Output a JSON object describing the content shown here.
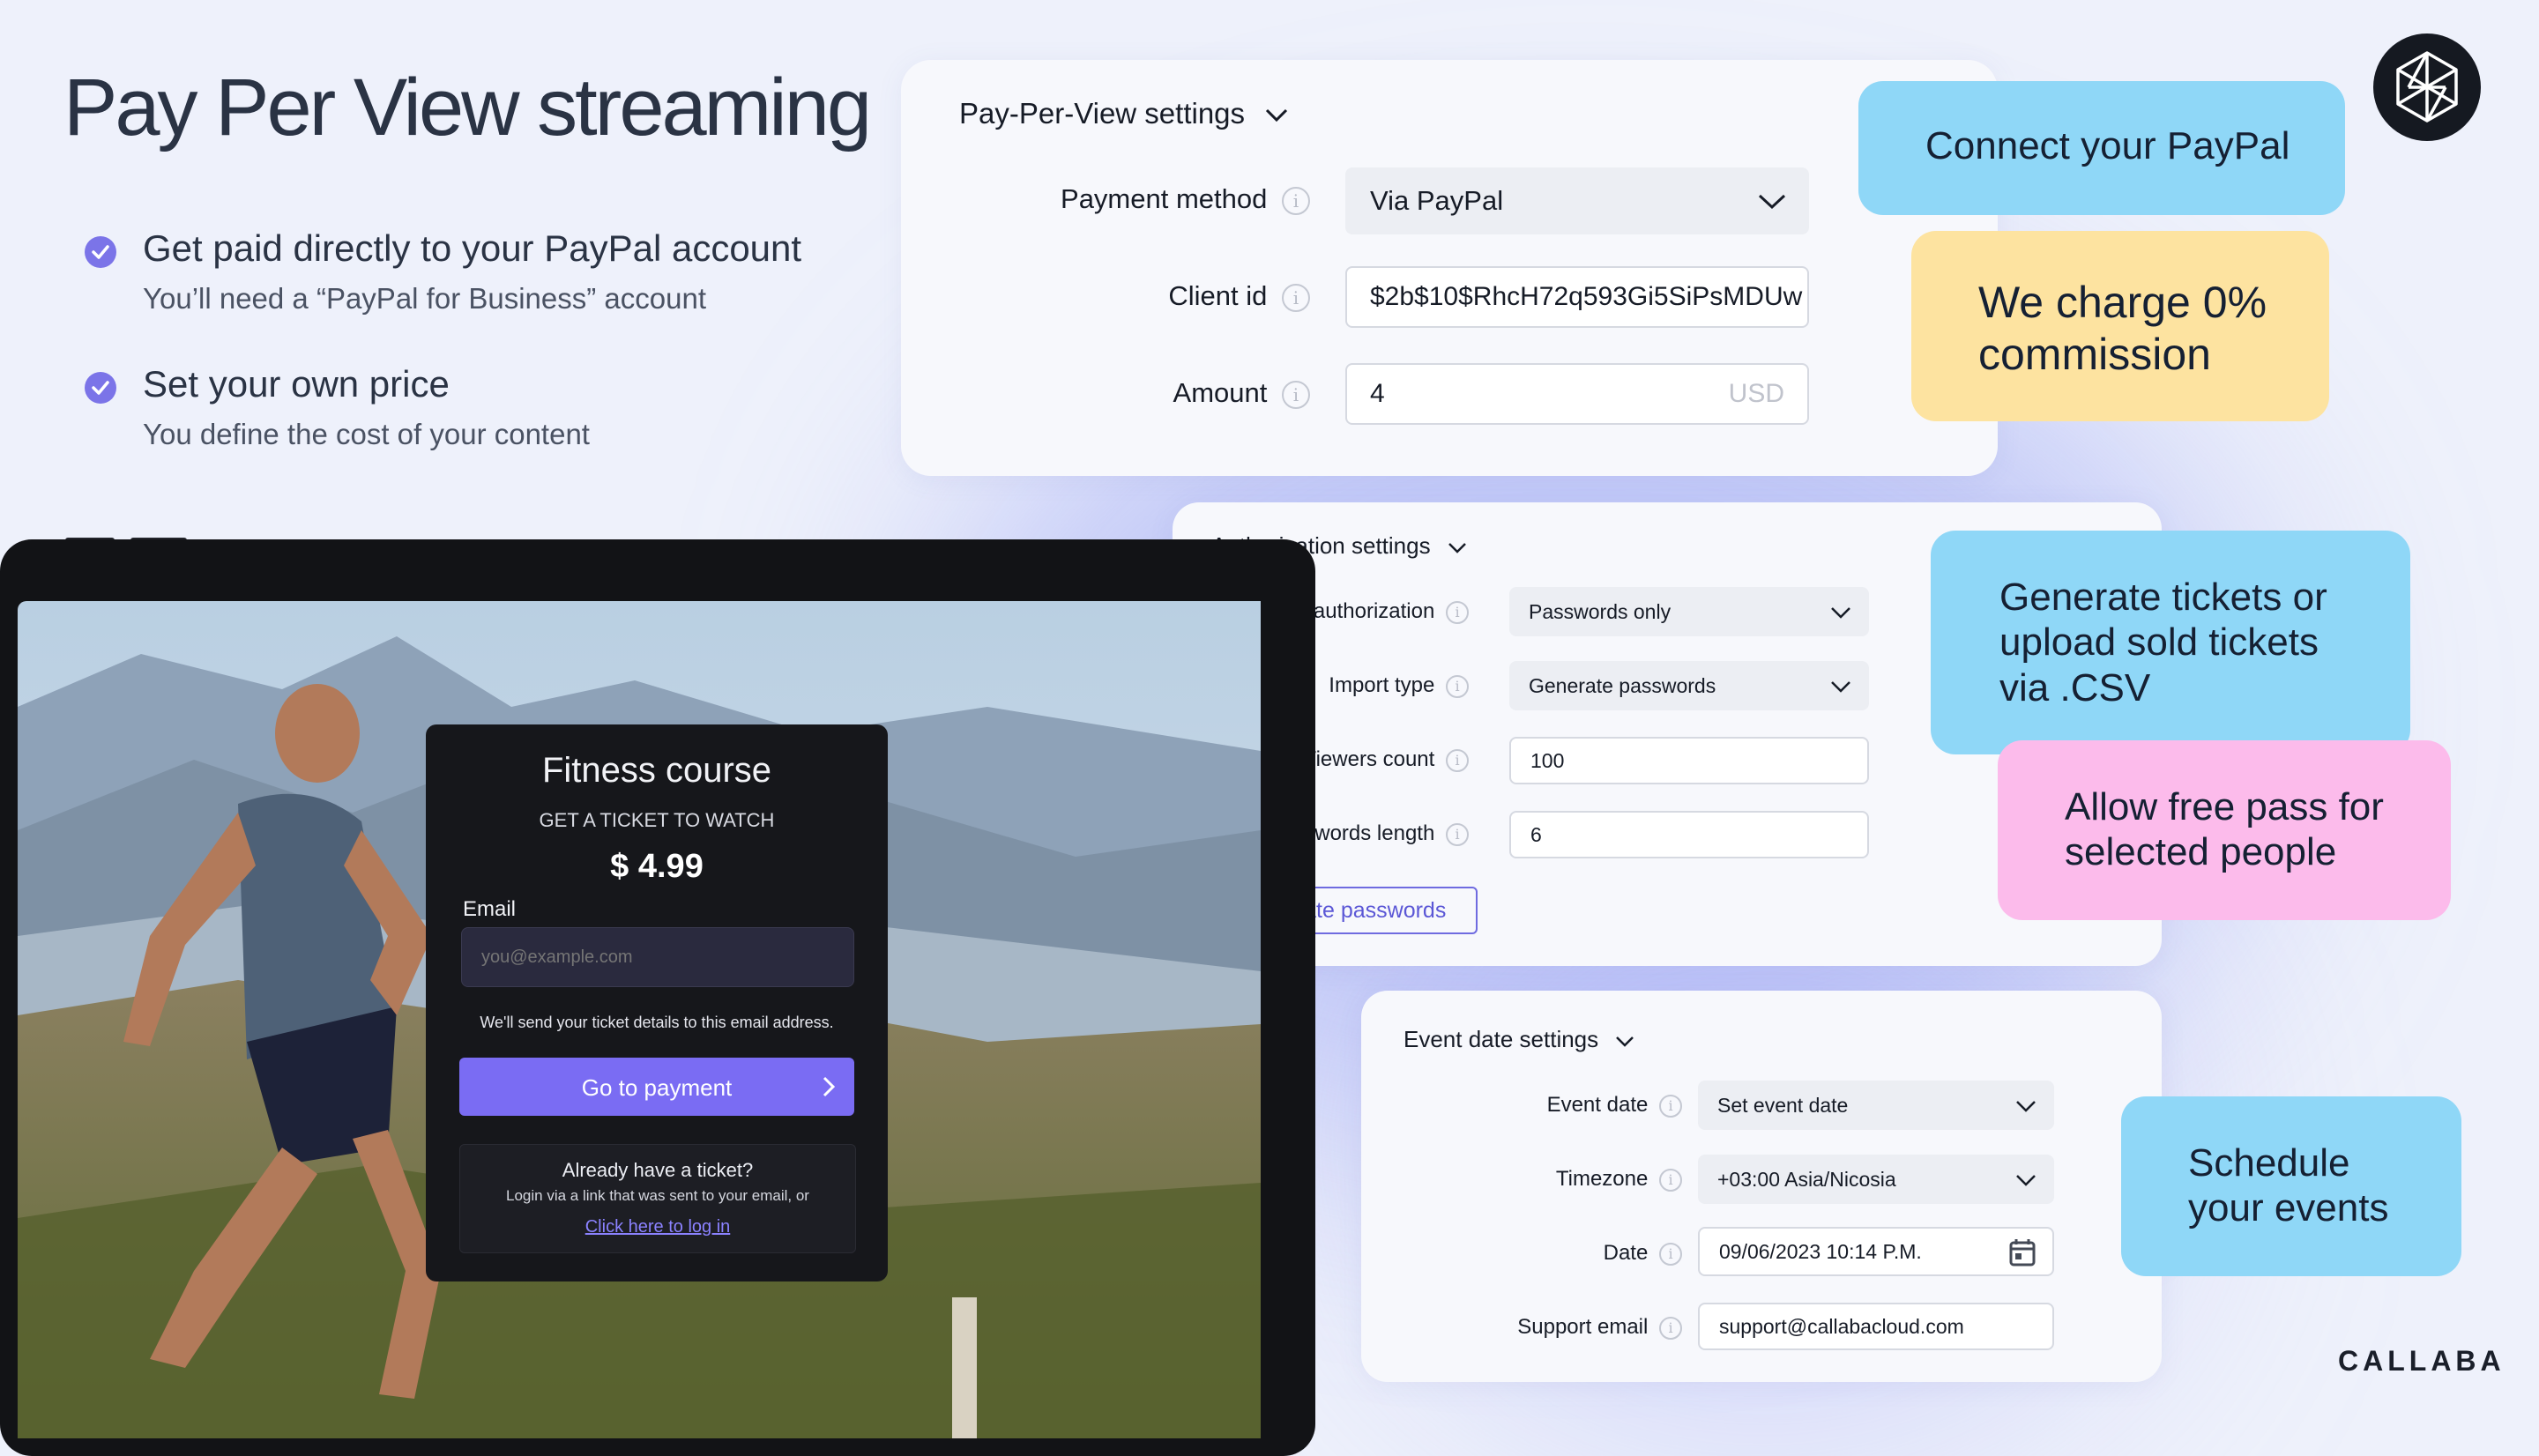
{
  "header": {
    "title": "Pay Per View streaming",
    "bullets": [
      {
        "heading": "Get paid directly to your PayPal account",
        "sub": "You’ll need a “PayPal for Business” account"
      },
      {
        "heading": "Set your own price",
        "sub": "You define the cost of your content"
      }
    ]
  },
  "ppv": {
    "title": "Pay-Per-View settings",
    "payment_method_label": "Payment method",
    "payment_method_value": "Via PayPal",
    "client_id_label": "Client id",
    "client_id_value": "$2b$10$RhcH72q593Gi5SiPsMDUw",
    "amount_label": "Amount",
    "amount_value": "4",
    "amount_currency": "USD"
  },
  "auth": {
    "title": "Authorization settings",
    "use_auth_label": "Use authorization",
    "use_auth_value": "Passwords only",
    "import_type_label": "Import type",
    "import_type_value": "Generate passwords",
    "viewers_count_label": "Viewers count",
    "viewers_count_value": "100",
    "passwords_length_label": "Passwords length",
    "passwords_length_value": "6",
    "generate_button": "Generate passwords"
  },
  "event": {
    "title": "Event date settings",
    "event_date_label": "Event date",
    "event_date_value": "Set event date",
    "timezone_label": "Timezone",
    "timezone_value": "+03:00 Asia/Nicosia",
    "date_label": "Date",
    "date_value": "09/06/2023 10:14 P.M.",
    "support_email_label": "Support email",
    "support_email_value": "support@callabacloud.com"
  },
  "callouts": {
    "paypal": "Connect your PayPal",
    "commission": "We charge 0% commission",
    "tickets": "Generate tickets or upload sold tickets via .CSV",
    "free_pass": "Allow free pass for selected people",
    "schedule": "Schedule your events"
  },
  "ticket_card": {
    "title": "Fitness course",
    "subtitle": "GET A TICKET TO WATCH",
    "price": "$ 4.99",
    "email_label": "Email",
    "email_placeholder": "you@example.com",
    "note": "We'll send your ticket details to this email address.",
    "pay_button": "Go to payment",
    "have_ticket": "Already have a ticket?",
    "login_hint": "Login via a link that was sent to your email, or",
    "login_link": "Click here to log in"
  },
  "brand": {
    "name": "CALLABA"
  },
  "colors": {
    "accent": "#7b74e8",
    "callout_blue": "#8fd7f7",
    "callout_yellow": "#fde3a0",
    "callout_pink": "#fcbbeb",
    "card_bg": "#16171b"
  }
}
